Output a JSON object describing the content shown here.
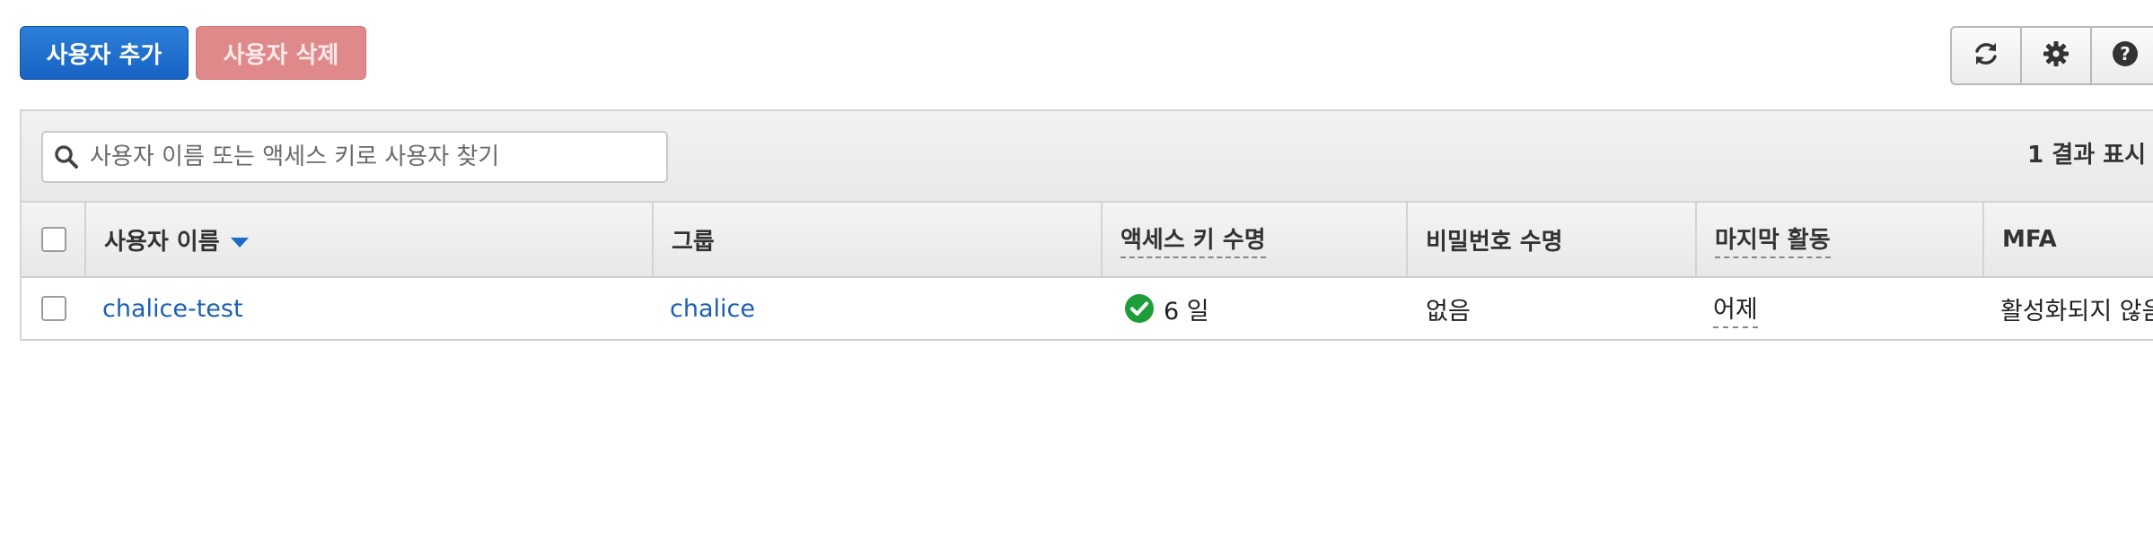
{
  "toolbar": {
    "add_user_label": "사용자 추가",
    "delete_user_label": "사용자 삭제",
    "icons": [
      "refresh-icon",
      "settings-icon",
      "help-icon"
    ]
  },
  "search": {
    "placeholder": "사용자 이름 또는 액세스 키로 사용자 찾기",
    "value": "",
    "result_count": "1 결과 표시"
  },
  "table": {
    "headers": {
      "username": "사용자 이름",
      "groups": "그룹",
      "access_key_age": "액세스 키 수명",
      "password_age": "비밀번호 수명",
      "last_activity": "마지막 활동",
      "mfa": "MFA"
    },
    "rows": [
      {
        "username": "chalice-test",
        "groups": "chalice",
        "access_key_age": "6 일",
        "password_age": "없음",
        "last_activity": "어제",
        "mfa": "활성화되지 않음"
      }
    ]
  },
  "colors": {
    "primary": "#1863c4",
    "danger": "#e0898a",
    "link": "#1a5fb4",
    "success": "#1e9e3a"
  }
}
